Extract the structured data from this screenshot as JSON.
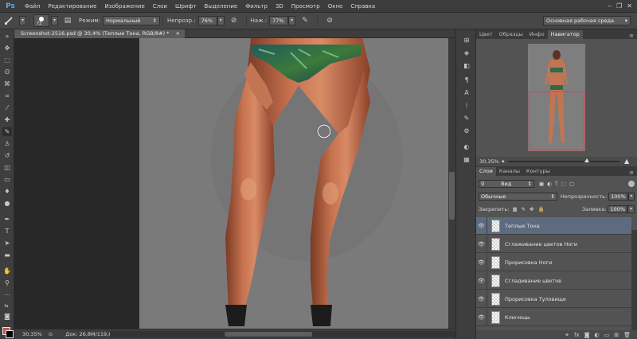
{
  "app": {
    "logo": "Ps",
    "menu": [
      "Файл",
      "Редактирование",
      "Изображение",
      "Слои",
      "Шрифт",
      "Выделение",
      "Фильтр",
      "3D",
      "Просмотр",
      "Окно",
      "Справка"
    ]
  },
  "options": {
    "brush_size": "72",
    "mode_label": "Режим:",
    "mode_value": "Нормальный",
    "opacity_label": "Непрозр.:",
    "opacity_value": "76%",
    "flow_label": "Наж.:",
    "flow_value": "77%",
    "workspace": "Основная рабочая среда"
  },
  "document": {
    "tab_title": "Screenshot-2516.psd @ 30,4% (Теплые Тона, RGB/8#) *",
    "tab_close": "×"
  },
  "status": {
    "zoom": "30,35%",
    "doc_size": "Док: 26,8M/119,8M"
  },
  "panels": {
    "top_tabs": [
      "Цвет",
      "Образцы",
      "Инфо",
      "Навигатор"
    ],
    "nav_zoom": "30,35%",
    "layer_tabs": [
      "Слои",
      "Каналы",
      "Контуры"
    ],
    "filter_value": "Вид",
    "blend_value": "Обычные",
    "opacity_label": "Непрозрачность:",
    "opacity_value": "100%",
    "lock_label": "Закрепить:",
    "fill_label": "Заливка:",
    "fill_value": "100%"
  },
  "layers": [
    {
      "name": "Теплые Тона",
      "selected": true
    },
    {
      "name": "Сглаживание цветов Ноги",
      "selected": false
    },
    {
      "name": "Прорисовка Ноги",
      "selected": false
    },
    {
      "name": "Сгладивание цветов",
      "selected": false
    },
    {
      "name": "Прорисовка Туловище",
      "selected": false
    },
    {
      "name": "Ключецы",
      "selected": false
    }
  ],
  "colors": {
    "foreground": "#d3524a",
    "background": "#000000",
    "selected_layer": "#5d6b80"
  }
}
